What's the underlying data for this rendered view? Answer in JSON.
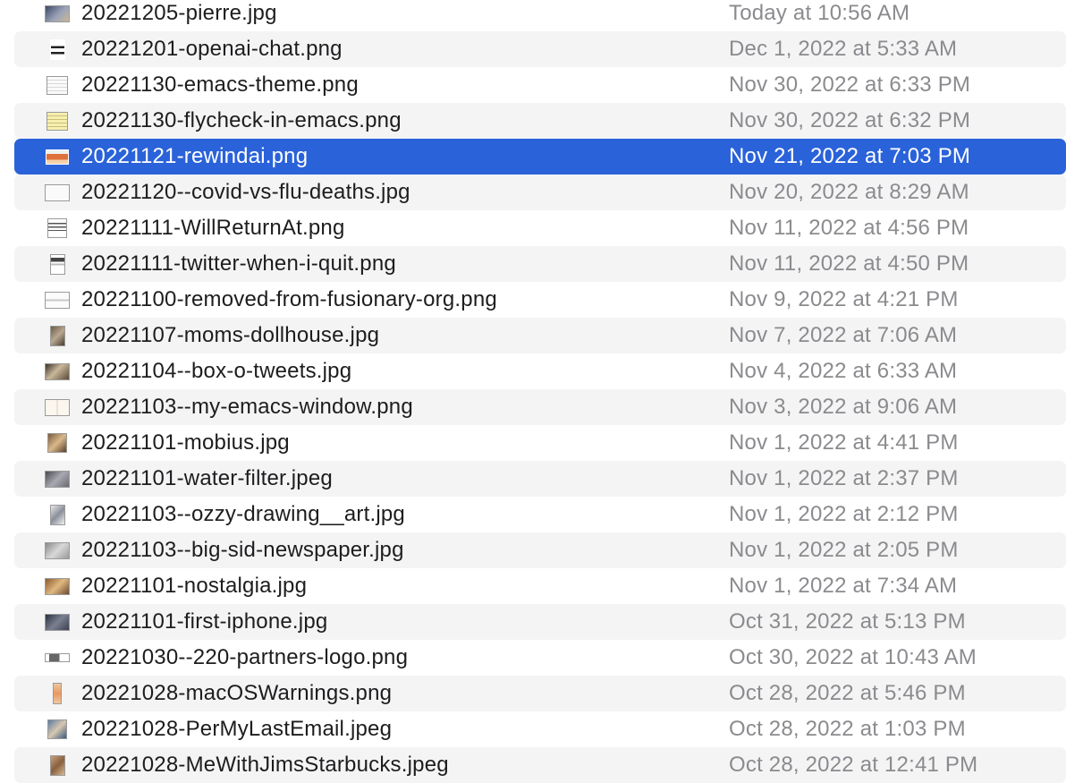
{
  "files": [
    {
      "name": "20221205-pierre.jpg",
      "date": "Today at 10:56 AM",
      "icon": "photo-thumbnail-icon"
    },
    {
      "name": "20221201-openai-chat.png",
      "date": "Dec 1, 2022 at 5:33 AM",
      "icon": "screenshot-thumbnail-icon"
    },
    {
      "name": "20221130-emacs-theme.png",
      "date": "Nov 30, 2022 at 6:33 PM",
      "icon": "screenshot-thumbnail-icon"
    },
    {
      "name": "20221130-flycheck-in-emacs.png",
      "date": "Nov 30, 2022 at 6:32 PM",
      "icon": "screenshot-thumbnail-icon"
    },
    {
      "name": "20221121-rewindai.png",
      "date": "Nov 21, 2022 at 7:03 PM",
      "icon": "screenshot-thumbnail-icon"
    },
    {
      "name": "20221120--covid-vs-flu-deaths.jpg",
      "date": "Nov 20, 2022 at 8:29 AM",
      "icon": "photo-thumbnail-icon"
    },
    {
      "name": "20221111-WillReturnAt.png",
      "date": "Nov 11, 2022 at 4:56 PM",
      "icon": "screenshot-thumbnail-icon"
    },
    {
      "name": "20221111-twitter-when-i-quit.png",
      "date": "Nov 11, 2022 at 4:50 PM",
      "icon": "screenshot-thumbnail-icon"
    },
    {
      "name": "20221100-removed-from-fusionary-org.png",
      "date": "Nov 9, 2022 at 4:21 PM",
      "icon": "screenshot-thumbnail-icon"
    },
    {
      "name": "20221107-moms-dollhouse.jpg",
      "date": "Nov 7, 2022 at 7:06 AM",
      "icon": "photo-thumbnail-icon"
    },
    {
      "name": "20221104--box-o-tweets.jpg",
      "date": "Nov 4, 2022 at 6:33 AM",
      "icon": "photo-thumbnail-icon"
    },
    {
      "name": "20221103--my-emacs-window.png",
      "date": "Nov 3, 2022 at 9:06 AM",
      "icon": "screenshot-thumbnail-icon"
    },
    {
      "name": "20221101-mobius.jpg",
      "date": "Nov 1, 2022 at 4:41 PM",
      "icon": "photo-thumbnail-icon"
    },
    {
      "name": "20221101-water-filter.jpeg",
      "date": "Nov 1, 2022 at 2:37 PM",
      "icon": "photo-thumbnail-icon"
    },
    {
      "name": "20221103--ozzy-drawing__art.jpg",
      "date": "Nov 1, 2022 at 2:12 PM",
      "icon": "photo-thumbnail-icon"
    },
    {
      "name": "20221103--big-sid-newspaper.jpg",
      "date": "Nov 1, 2022 at 2:05 PM",
      "icon": "photo-thumbnail-icon"
    },
    {
      "name": "20221101-nostalgia.jpg",
      "date": "Nov 1, 2022 at 7:34 AM",
      "icon": "photo-thumbnail-icon"
    },
    {
      "name": "20221101-first-iphone.jpg",
      "date": "Oct 31, 2022 at 5:13 PM",
      "icon": "photo-thumbnail-icon"
    },
    {
      "name": "20221030--220-partners-logo.png",
      "date": "Oct 30, 2022 at 10:43 AM",
      "icon": "screenshot-thumbnail-icon"
    },
    {
      "name": "20221028-macOSWarnings.png",
      "date": "Oct 28, 2022 at 5:46 PM",
      "icon": "screenshot-thumbnail-icon"
    },
    {
      "name": "20221028-PerMyLastEmail.jpeg",
      "date": "Oct 28, 2022 at 1:03 PM",
      "icon": "photo-thumbnail-icon"
    },
    {
      "name": "20221028-MeWithJimsStarbucks.jpeg",
      "date": "Oct 28, 2022 at 12:41 PM",
      "icon": "photo-thumbnail-icon"
    }
  ],
  "selected_index": 4,
  "colors": {
    "selection": "#2a62d9",
    "stripe": "#f4f4f5",
    "name_text": "#1d1d1f",
    "date_text": "#8b8b8f"
  }
}
